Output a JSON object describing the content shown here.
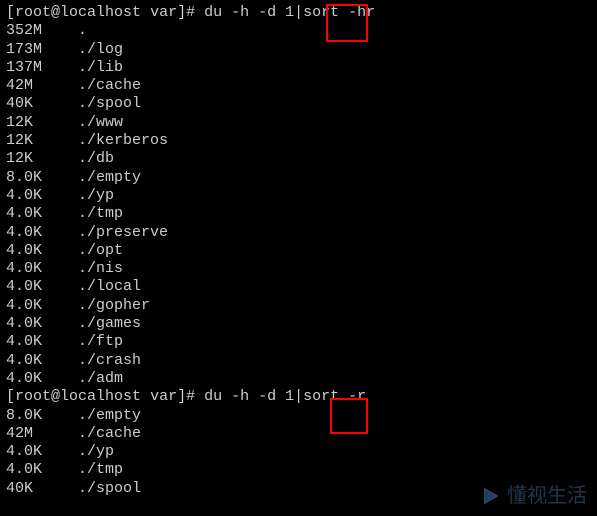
{
  "prompt1": {
    "user_host": "root@localhost",
    "dir": "var",
    "command": "du -h -d 1|sort -hr"
  },
  "output1": [
    {
      "size": "352M",
      "path": "."
    },
    {
      "size": "173M",
      "path": "./log"
    },
    {
      "size": "137M",
      "path": "./lib"
    },
    {
      "size": "42M",
      "path": "./cache"
    },
    {
      "size": "40K",
      "path": "./spool"
    },
    {
      "size": "12K",
      "path": "./www"
    },
    {
      "size": "12K",
      "path": "./kerberos"
    },
    {
      "size": "12K",
      "path": "./db"
    },
    {
      "size": "8.0K",
      "path": "./empty"
    },
    {
      "size": "4.0K",
      "path": "./yp"
    },
    {
      "size": "4.0K",
      "path": "./tmp"
    },
    {
      "size": "4.0K",
      "path": "./preserve"
    },
    {
      "size": "4.0K",
      "path": "./opt"
    },
    {
      "size": "4.0K",
      "path": "./nis"
    },
    {
      "size": "4.0K",
      "path": "./local"
    },
    {
      "size": "4.0K",
      "path": "./gopher"
    },
    {
      "size": "4.0K",
      "path": "./games"
    },
    {
      "size": "4.0K",
      "path": "./ftp"
    },
    {
      "size": "4.0K",
      "path": "./crash"
    },
    {
      "size": "4.0K",
      "path": "./adm"
    }
  ],
  "prompt2": {
    "user_host": "root@localhost",
    "dir": "var",
    "command": "du -h -d 1|sort -r"
  },
  "output2": [
    {
      "size": "8.0K",
      "path": "./empty"
    },
    {
      "size": "42M",
      "path": "./cache"
    },
    {
      "size": "4.0K",
      "path": "./yp"
    },
    {
      "size": "4.0K",
      "path": "./tmp"
    },
    {
      "size": "40K",
      "path": "./spool"
    }
  ],
  "watermark_text": "懂视生活"
}
